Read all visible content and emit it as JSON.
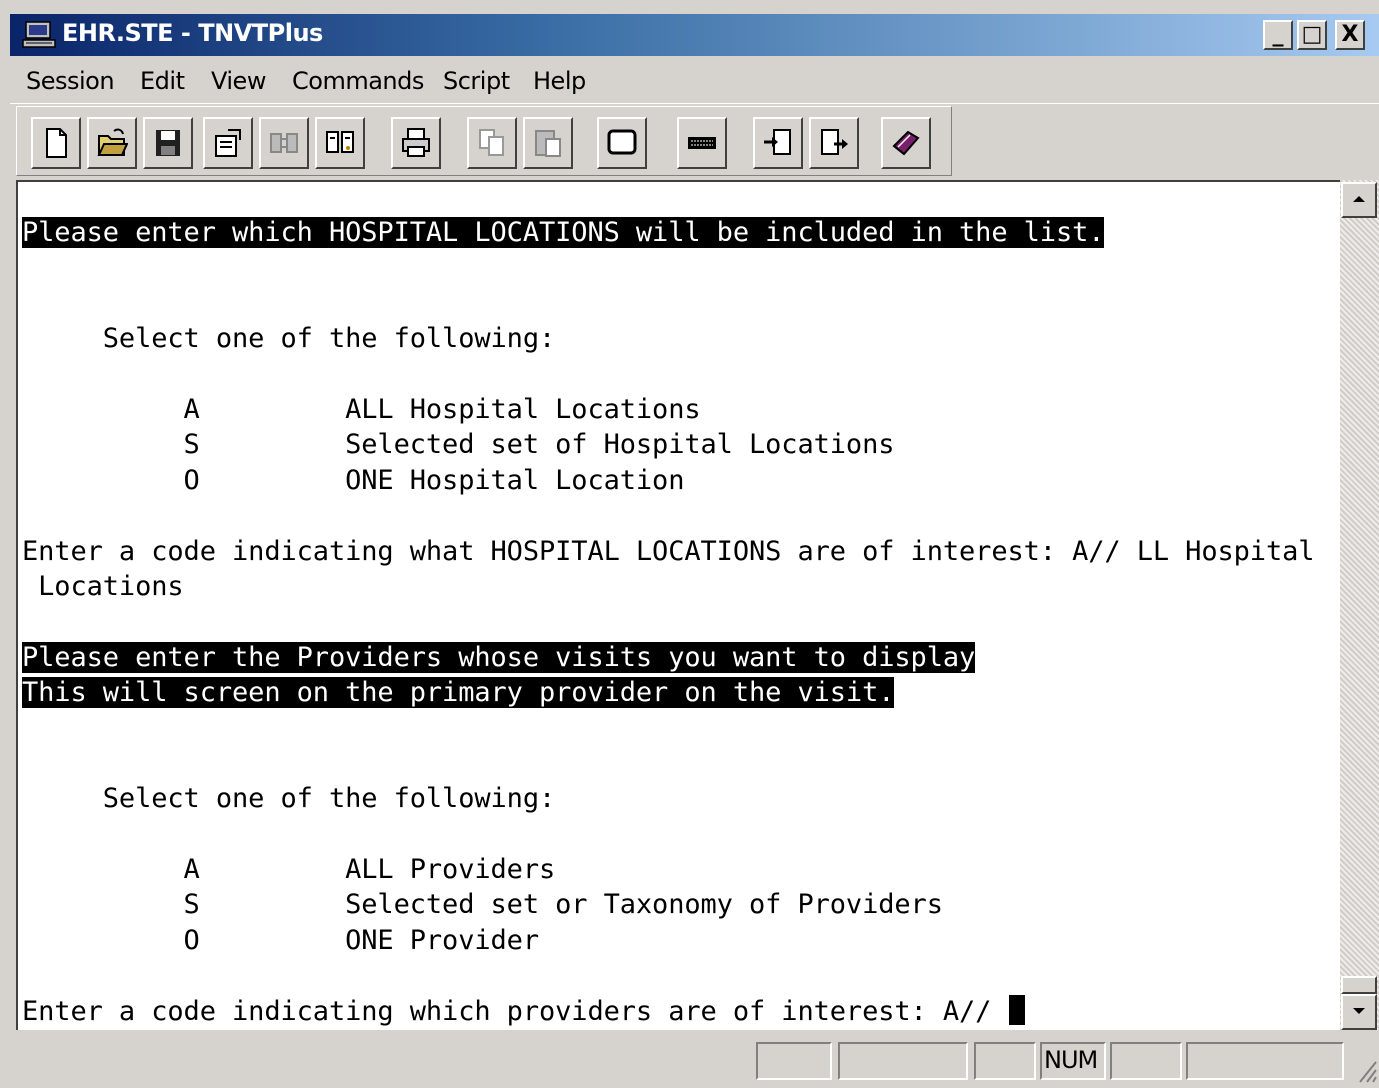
{
  "window": {
    "title": "EHR.STE - TNVTPlus",
    "controls": {
      "minimize": "_",
      "maximize": "□",
      "close": "X"
    }
  },
  "menu": {
    "items": [
      {
        "label": "Session"
      },
      {
        "label": "Edit"
      },
      {
        "label": "View"
      },
      {
        "label": "Commands"
      },
      {
        "label": "Script"
      },
      {
        "label": "Help"
      }
    ]
  },
  "toolbar": {
    "buttons": [
      {
        "icon": "new-document-icon"
      },
      {
        "icon": "open-folder-icon"
      },
      {
        "icon": "save-disk-icon"
      },
      {
        "icon": "properties-icon"
      },
      {
        "icon": "disconnect-icon"
      },
      {
        "icon": "connect-icon"
      },
      {
        "icon": "print-icon"
      },
      {
        "icon": "copy-icon"
      },
      {
        "icon": "paste-icon"
      },
      {
        "icon": "screen-icon"
      },
      {
        "icon": "keyboard-icon"
      },
      {
        "icon": "receive-file-icon"
      },
      {
        "icon": "send-file-icon"
      },
      {
        "icon": "help-book-icon"
      }
    ]
  },
  "terminal": {
    "lines": [
      {
        "text": "Please enter which HOSPITAL LOCATIONS will be included in the list.",
        "inverse": true
      },
      {
        "text": "     Select one of the following:"
      },
      {
        "text": "          A         ALL Hospital Locations"
      },
      {
        "text": "          S         Selected set of Hospital Locations"
      },
      {
        "text": "          O         ONE Hospital Location"
      },
      {
        "text": "Enter a code indicating what HOSPITAL LOCATIONS are of interest: A// LL Hospital"
      },
      {
        "text": " Locations"
      },
      {
        "text": "Please enter the Providers whose visits you want to display",
        "inverse": true
      },
      {
        "text": "This will screen on the primary provider on the visit.",
        "inverse": true
      },
      {
        "text": "     Select one of the following:"
      },
      {
        "text": "          A         ALL Providers"
      },
      {
        "text": "          S         Selected set or Taxonomy of Providers"
      },
      {
        "text": "          O         ONE Provider"
      },
      {
        "text": "Enter a code indicating which providers are of interest: A// "
      }
    ]
  },
  "statusbar": {
    "num_indicator": "NUM"
  }
}
